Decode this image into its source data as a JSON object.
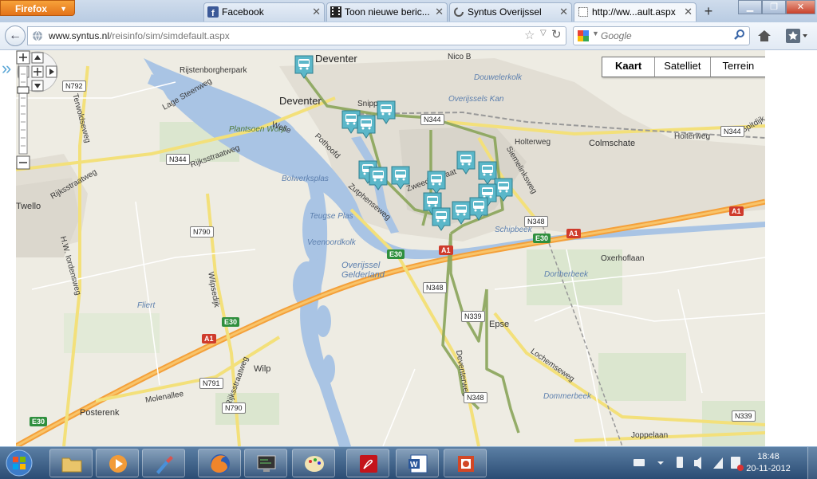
{
  "browser": {
    "app_button": "Firefox",
    "tabs": [
      {
        "label": "Facebook",
        "icon": "facebook-icon"
      },
      {
        "label": "Toon nieuwe beric...",
        "icon": "film-icon"
      },
      {
        "label": "Syntus Overijssel",
        "icon": "loading-icon"
      },
      {
        "label": "http://ww...ault.aspx",
        "icon": "blank-page-icon"
      }
    ],
    "new_tab": "+",
    "url_domain": "www.syntus.nl",
    "url_path": "/reisinfo/sim/simdefault.aspx",
    "search_placeholder": "Google"
  },
  "map": {
    "map_types": [
      "Kaart",
      "Satelliet",
      "Terrein"
    ],
    "selected_map_type": "Kaart",
    "places": [
      "Deventer",
      "Deventer",
      "Rijstenborgherpark",
      "Colmschate",
      "Twello",
      "Epse",
      "Wilp",
      "Posterenk",
      "Oxerhoflaan",
      "Snipp",
      "Nico B"
    ],
    "water_labels": [
      "Bolwerksplas",
      "Teugse Plas",
      "Veenoordkolk",
      "Douwelerkolk",
      "Overijssels Kan",
      "Schipbeek",
      "Dortherbeek",
      "Dommerbeek",
      "Overijssel",
      "Gelderland",
      "Fliert",
      "Plantsoen Worp"
    ],
    "road_labels": [
      "Welle",
      "Pothoofd",
      "Zutphenseweg",
      "Zweedsestraat",
      "Holterweg",
      "Holterweg",
      "Siemelinksweg",
      "Rijksstraatweg",
      "Rijksstraatweg",
      "Lage Steenweg",
      "Terwoldseweg",
      "H.W. Iordensweg",
      "Wilpsedijk",
      "Deventerweg",
      "Lochemseweg",
      "Molenallee",
      "Joppelaan",
      "Spitdijk",
      "Rijksstraatweg"
    ],
    "route_shields": [
      "N344",
      "N344",
      "N344",
      "N792",
      "N790",
      "N790",
      "N791",
      "N348",
      "N348",
      "N348",
      "N339",
      "N339",
      "A1",
      "A1",
      "A1",
      "A1",
      "E30",
      "E30",
      "E30",
      "E30"
    ]
  },
  "taskbar": {
    "time": "18:48",
    "date": "20-11-2012"
  }
}
